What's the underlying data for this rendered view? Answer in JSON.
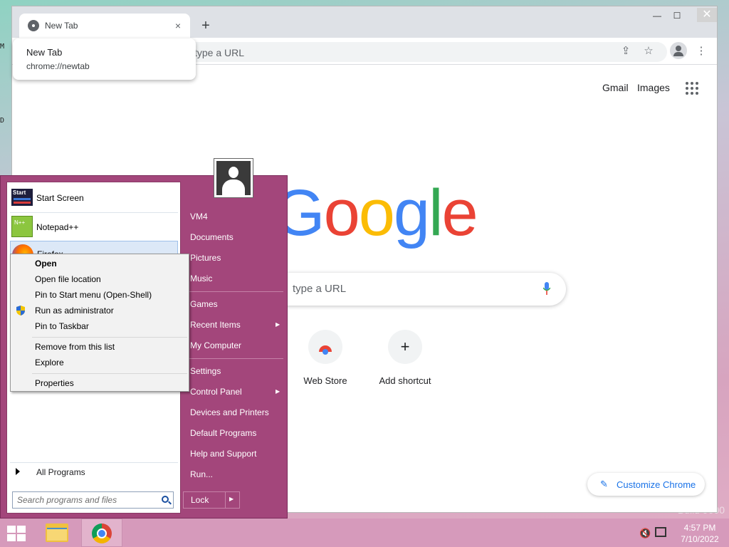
{
  "chrome": {
    "tab_title": "New Tab",
    "tab_close": "×",
    "new_tab": "+",
    "tooltip_title": "New Tab",
    "tooltip_url": "chrome://newtab",
    "omnibox_placeholder": "type a URL",
    "window_minimize": "—",
    "window_maximize": "☐",
    "window_close": "✕",
    "gmail": "Gmail",
    "images": "Images",
    "search_placeholder": "type a URL",
    "shortcuts": [
      {
        "label": "Web Store"
      },
      {
        "label": "Add shortcut",
        "glyph": "+"
      }
    ],
    "customize": "Customize Chrome",
    "logo_letters": [
      "G",
      "o",
      "o",
      "g",
      "l",
      "e"
    ],
    "logo_colors": [
      "#4285F4",
      "#EA4335",
      "#FBBC05",
      "#4285F4",
      "#34A853",
      "#EA4335"
    ]
  },
  "start_menu": {
    "pinned": [
      {
        "label": "Start Screen",
        "icon": "start-screen-icon",
        "icon_text": "Start"
      },
      {
        "label": "Notepad++",
        "icon": "notepadpp-icon",
        "icon_text": "N++"
      },
      {
        "label": "Firefox",
        "icon": "firefox-icon"
      }
    ],
    "all_programs": "All Programs",
    "search_placeholder": "Search programs and files",
    "right": [
      "VM4",
      "Documents",
      "Pictures",
      "Music",
      "Games",
      "Recent Items",
      "My Computer",
      "Settings",
      "Control Panel",
      "Devices and Printers",
      "Default Programs",
      "Help and Support",
      "Run..."
    ],
    "lock": "Lock"
  },
  "context_menu": [
    "Open",
    "Open file location",
    "Pin to Start menu (Open-Shell)",
    "Run as administrator",
    "Pin to Taskbar",
    "Remove from this list",
    "Explore",
    "Properties"
  ],
  "taskbar": {
    "time": "4:57 PM",
    "date": "7/10/2022"
  },
  "desktop": {
    "watermark": "Build 9600"
  }
}
